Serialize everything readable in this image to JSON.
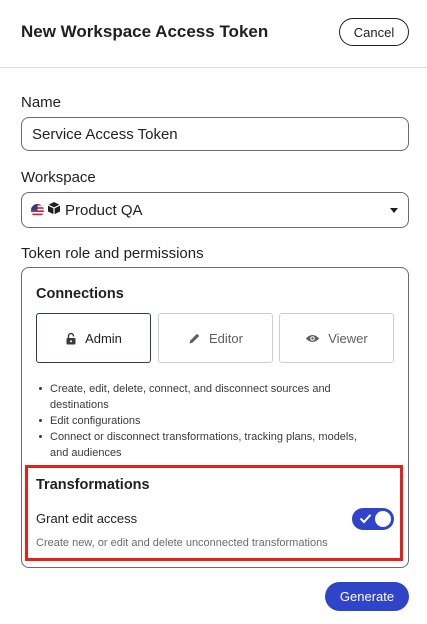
{
  "dialog": {
    "title": "New Workspace Access Token",
    "cancel_label": "Cancel",
    "generate_label": "Generate"
  },
  "name_field": {
    "label": "Name",
    "value": "Service Access Token"
  },
  "workspace_field": {
    "label": "Workspace",
    "selected_value": "Product QA",
    "icons": [
      "us-flag-icon",
      "cube-icon"
    ]
  },
  "permissions": {
    "label": "Token role and permissions",
    "connections": {
      "title": "Connections",
      "roles": [
        {
          "label": "Admin",
          "icon": "lock-icon",
          "selected": true
        },
        {
          "label": "Editor",
          "icon": "pencil-icon",
          "selected": false
        },
        {
          "label": "Viewer",
          "icon": "eye-icon",
          "selected": false
        }
      ],
      "admin_permissions": [
        "Create, edit, delete, connect, and disconnect sources and destinations",
        "Edit configurations",
        "Connect or disconnect transformations, tracking plans, models, and audiences"
      ]
    },
    "transformations": {
      "title": "Transformations",
      "grant_label": "Grant edit access",
      "grant_enabled": true,
      "help_text": "Create new, or edit and delete unconnected transformations"
    }
  },
  "colors": {
    "primary": "#2f44c8",
    "highlight": "#e8201a",
    "text": "#1f1f1f",
    "border": "#6b6b6b"
  }
}
